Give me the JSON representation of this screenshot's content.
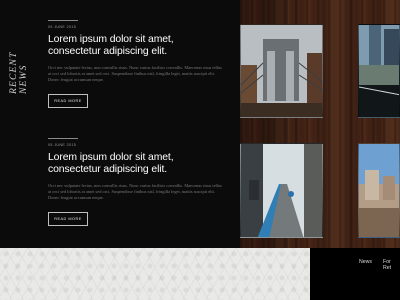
{
  "section": {
    "title": "RECENT NEWS"
  },
  "articles": [
    {
      "date": "05 JUNE 2015",
      "headline_line1": "Lorem ipsum dolor sit amet,",
      "headline_line2": "consectetur adipiscing elit.",
      "body": "Orci nec vulputate lectus, non convallis risus. Nunc varius facilisis convallis. Maecenas risus tellus at orci sed lobortis at amet sed orci. Suspendisse finibus nisl, fringilla leget, mattis suscipit elit. Donec feugiat accumsan neque.",
      "button_label": "READ MORE"
    },
    {
      "date": "05 JUNE 2015",
      "headline_line1": "Lorem ipsum dolor sit amet,",
      "headline_line2": "consectetur adipiscing elit.",
      "body": "Orci nec vulputate lectus, non convallis risus. Nunc varius facilisis convallis. Maecenas risus tellus at orci sed lobortis at amet sed orci. Suspendisse finibus nisl, fringilla leget, mattis suscipit elit. Donec feugiat accumsan neque.",
      "button_label": "READ MORE"
    }
  ],
  "photos": [
    {
      "subject": "bridge-between-brick-buildings"
    },
    {
      "subject": "memorial-pool-and-towers"
    },
    {
      "subject": "street-with-cyclist"
    },
    {
      "subject": "rooftop-city-view"
    }
  ],
  "footer": {
    "nav": [
      "News",
      "For Ret"
    ]
  },
  "colors": {
    "background": "#0b0b0b",
    "text": "#ffffff",
    "muted": "#7a7a7a",
    "wood": "#42221a"
  }
}
